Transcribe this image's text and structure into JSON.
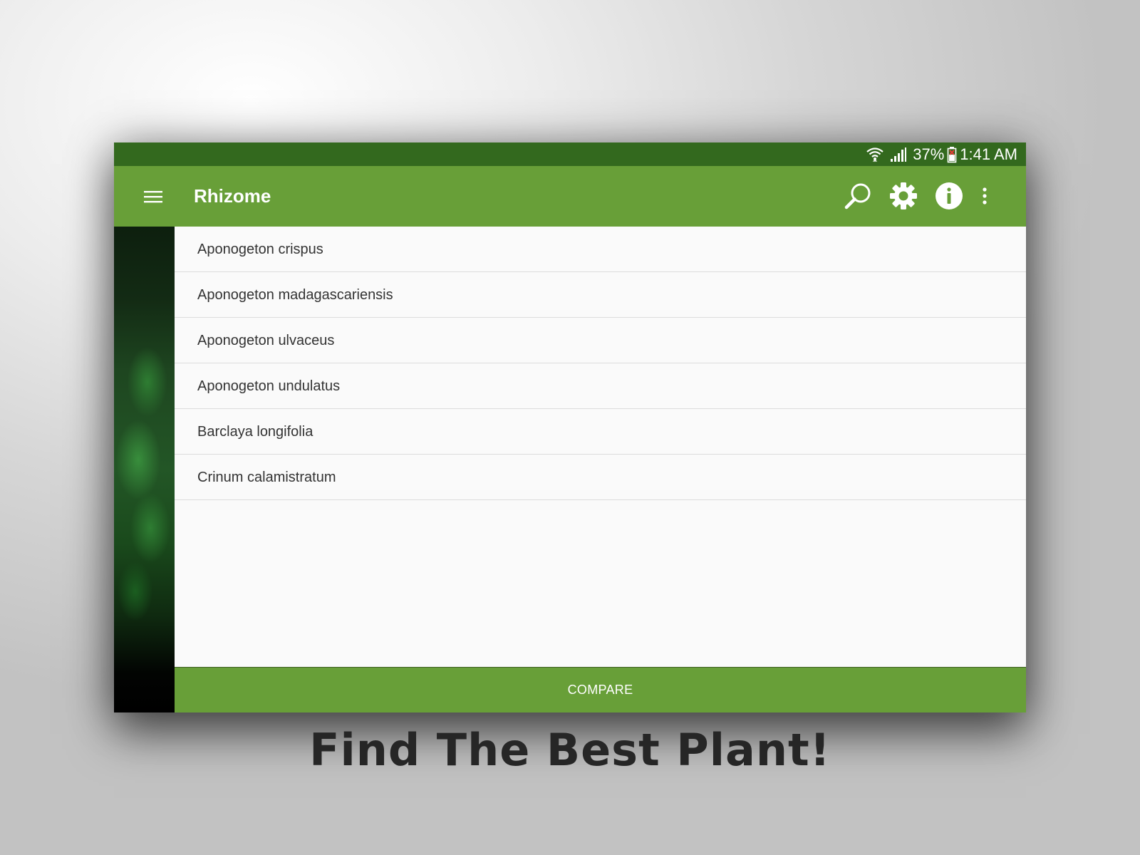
{
  "status_bar": {
    "battery_percent": "37%",
    "time": "1:41 AM",
    "icons": [
      "wifi-icon",
      "cell-signal-icon",
      "battery-icon"
    ]
  },
  "app_bar": {
    "title": "Rhizome",
    "icons": [
      "menu-icon",
      "search-icon",
      "gear-icon",
      "info-icon",
      "more-vert-icon"
    ]
  },
  "plants": [
    "Aponogeton crispus",
    "Aponogeton madagascariensis",
    "Aponogeton ulvaceus",
    "Aponogeton undulatus",
    "Barclaya longifolia",
    "Crinum calamistratum"
  ],
  "compare_label": "COMPARE",
  "tagline": "Find The Best Plant!",
  "colors": {
    "status_bar": "#33691e",
    "primary": "#689f38",
    "list_background": "#fafafa",
    "tagline": "#262626"
  }
}
